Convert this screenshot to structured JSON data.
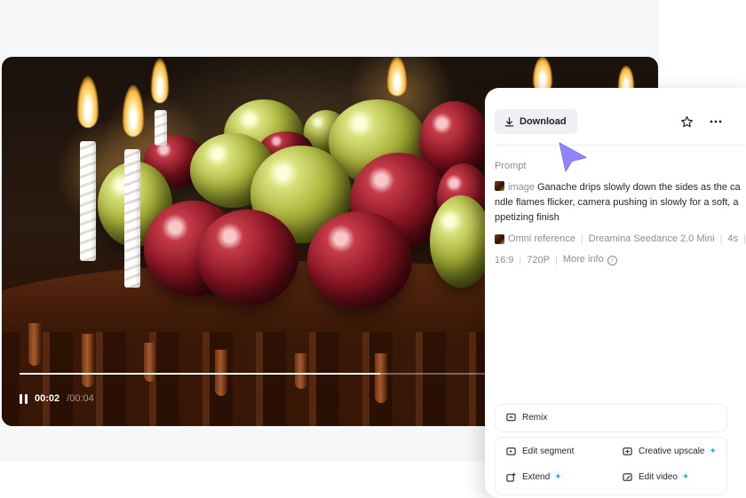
{
  "player": {
    "current_time": "00:02",
    "total_time": "00:04",
    "progress_fraction": 0.77
  },
  "panel": {
    "download_label": "Download",
    "prompt_label": "Prompt",
    "prompt_kind": "image",
    "prompt_text": "Ganache drips slowly down the sides as the candle flames flicker, camera pushing in slowly for a soft, appetizing finish",
    "meta": {
      "reference": "Omni reference",
      "model": "Dreamina Seedance 2.0 Mini",
      "duration": "4s",
      "ratio": "16:9",
      "resolution": "720P",
      "more_info": "More info"
    },
    "actions": {
      "remix": "Remix",
      "edit_segment": "Edit segment",
      "creative_upscale": "Creative upscale",
      "extend": "Extend",
      "edit_video": "Edit video"
    }
  },
  "colors": {
    "accent_cursor": "#8f86ff",
    "sparkle": "#1fb6e8",
    "muted_text": "#8a8d93"
  }
}
